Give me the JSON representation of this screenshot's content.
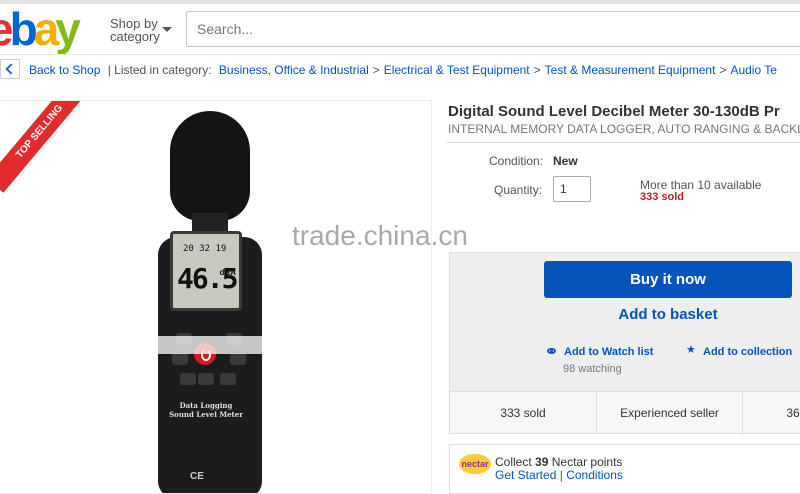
{
  "header": {
    "logo_letters": [
      "e",
      "b",
      "a",
      "y"
    ],
    "logo_colors": [
      "#e53238",
      "#0064d2",
      "#f5af02",
      "#86b817"
    ],
    "shop_by_line1": "Shop by",
    "shop_by_line2": "category",
    "search_placeholder": "Search..."
  },
  "breadcrumb": {
    "back_label": "Back to Shop",
    "listed_label": "| Listed in category:",
    "items": [
      "Business, Office & Industrial",
      "Electrical & Test Equipment",
      "Test & Measurement Equipment",
      "Audio Te"
    ]
  },
  "image": {
    "ribbon": "TOP SELLING",
    "watermark": "trade.china.cn",
    "lcd_value": "46.5",
    "lcd_time": "20 32 19",
    "lcd_unit": "dBA",
    "device_label_1": "Data Logging",
    "device_label_2": "Sound Level Meter",
    "mark": "CE"
  },
  "listing": {
    "title": "Digital Sound Level Decibel Meter 30-130dB Pr",
    "subtitle": "INTERNAL MEMORY DATA LOGGER, AUTO RANGING & BACKLIG",
    "condition_label": "Condition:",
    "condition_value": "New",
    "quantity_label": "Quantity:",
    "quantity_value": "1",
    "availability": "More than 10 available",
    "sold": "333 sold"
  },
  "buy": {
    "buy_now": "Buy it now",
    "add_basket": "Add to basket",
    "watch_list": "Add to Watch list",
    "watching": "98 watching",
    "collection": "Add to collection"
  },
  "stats": {
    "sold": "333 sold",
    "seller": "Experienced seller",
    "third": "36"
  },
  "nectar": {
    "logo_text": "nectar",
    "collect_prefix": "Collect",
    "points": "39",
    "collect_suffix": "Nectar points",
    "get_started": "Get Started",
    "separator": "|",
    "conditions": "Conditions"
  }
}
